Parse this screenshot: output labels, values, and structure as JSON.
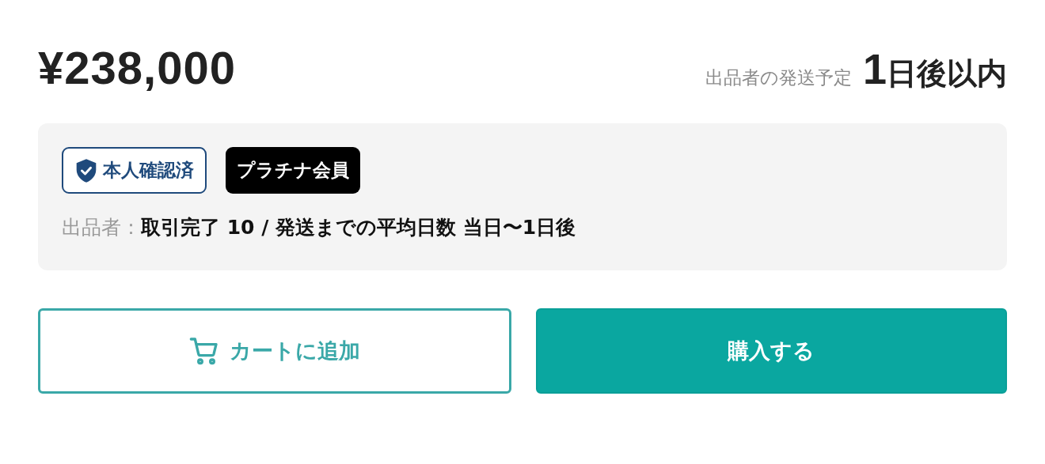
{
  "price": "¥238,000",
  "shipping": {
    "label": "出品者の発送予定",
    "days": "1",
    "suffix": "日後以内"
  },
  "seller": {
    "badges": [
      {
        "kind": "verified",
        "label": "本人確認済"
      },
      {
        "kind": "membership",
        "label": "プラチナ会員"
      }
    ],
    "label": "出品者：",
    "summary": "取引完了 10 / 発送までの平均日数 当日〜1日後"
  },
  "buttons": [
    {
      "kind": "cart",
      "label": "カートに追加"
    },
    {
      "kind": "buy",
      "label": "購入する"
    }
  ]
}
